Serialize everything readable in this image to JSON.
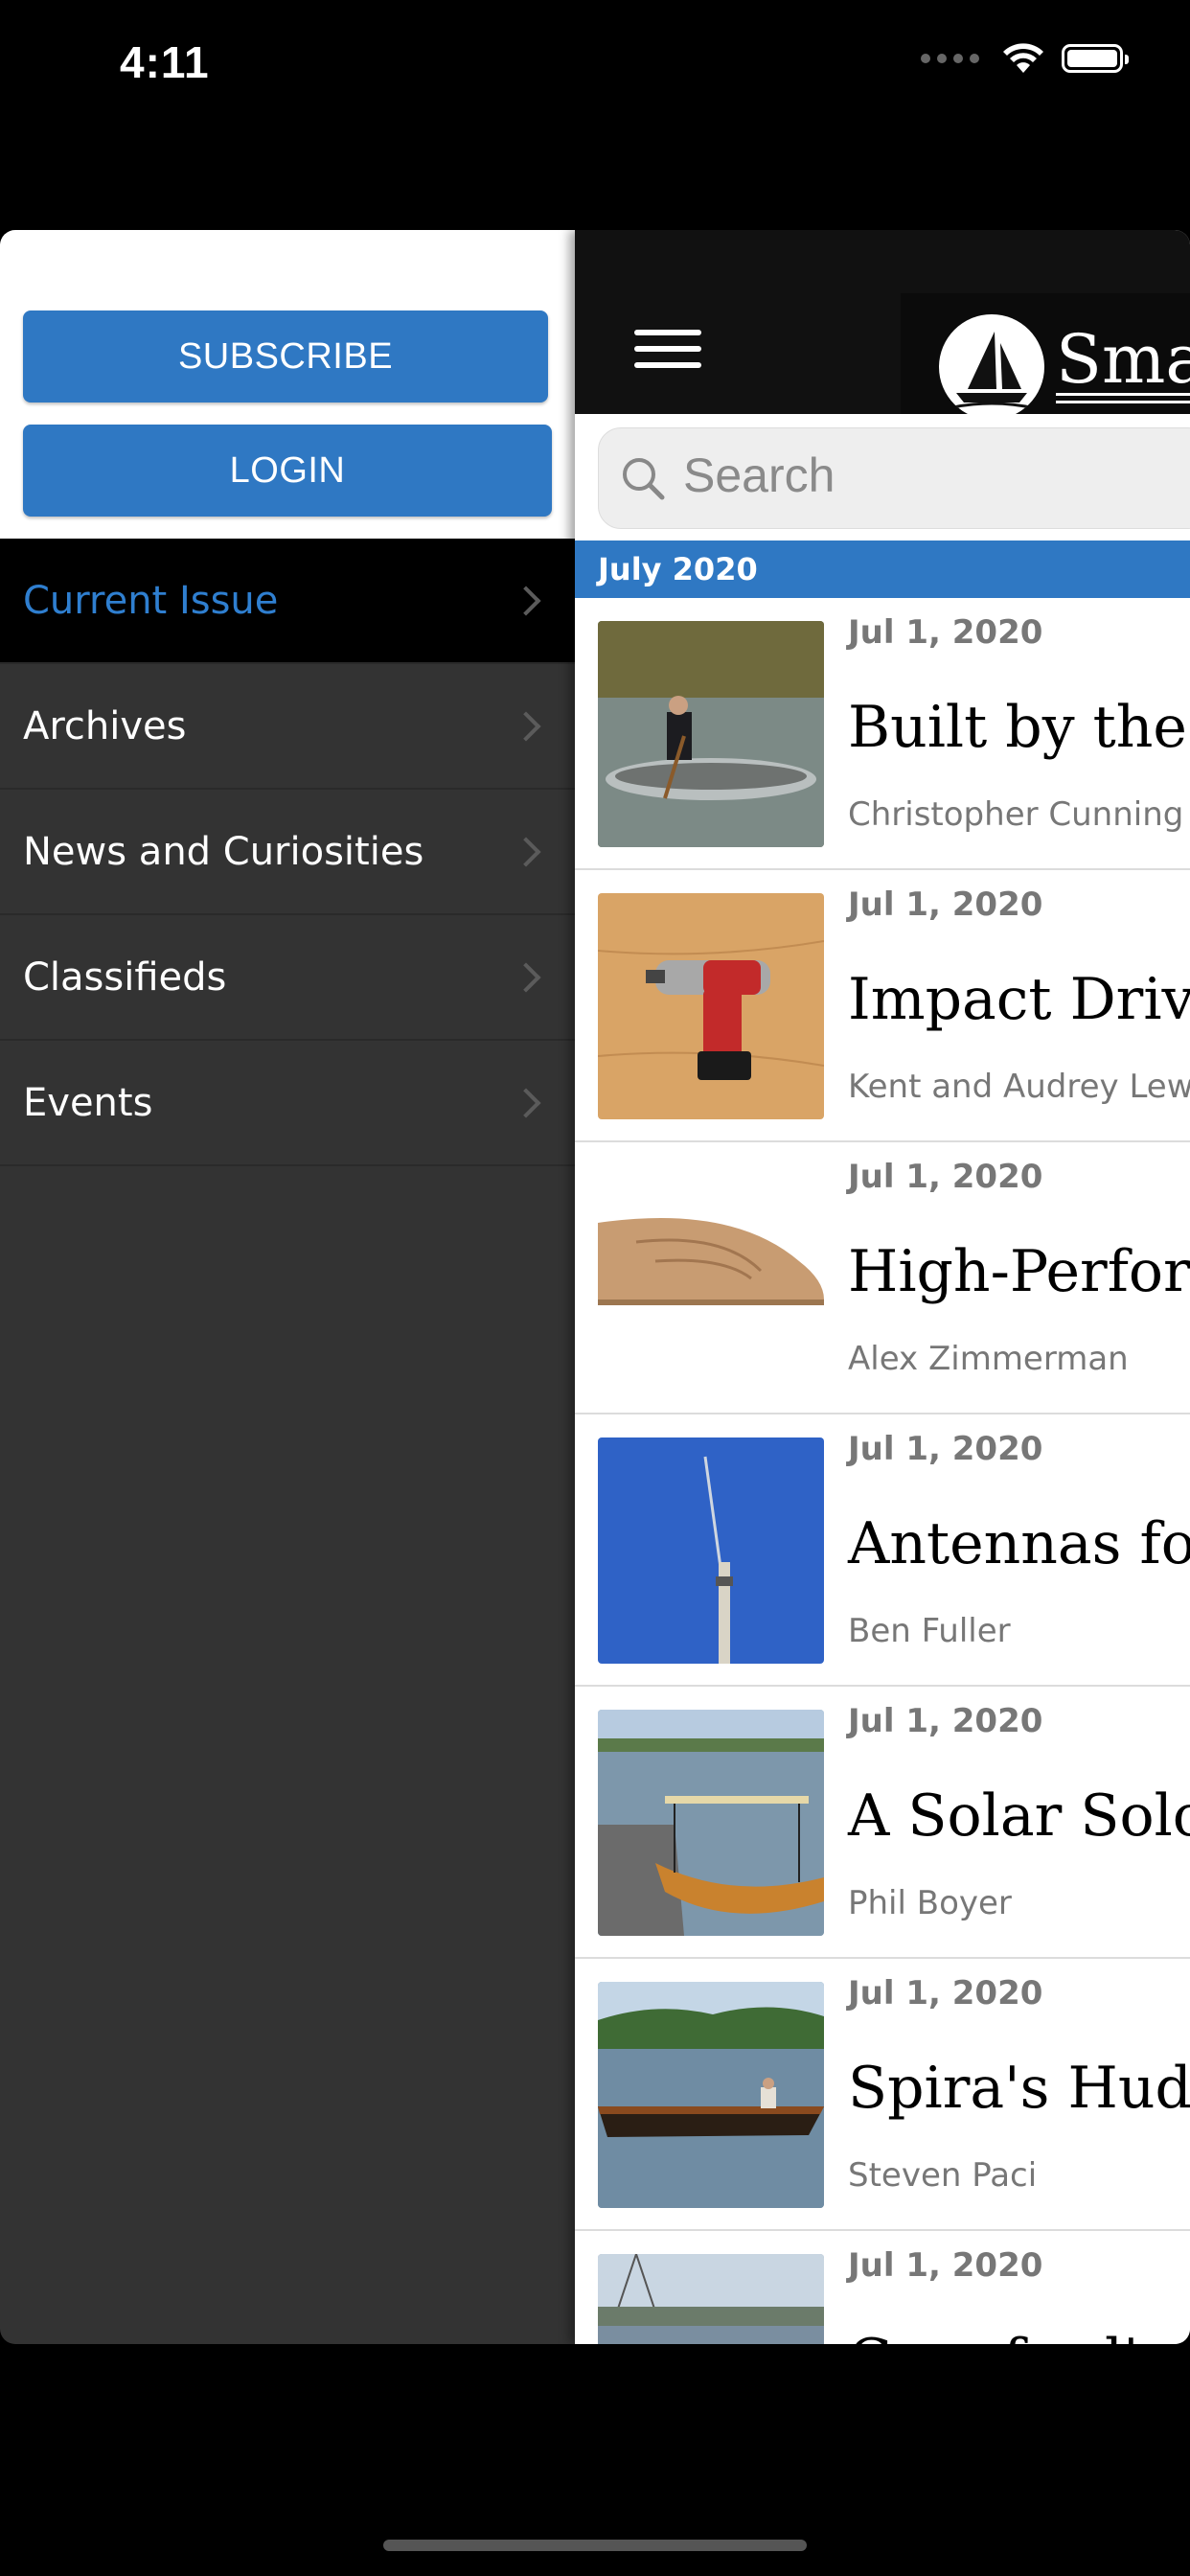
{
  "status": {
    "time": "4:11"
  },
  "drawer": {
    "subscribe_label": "SUBSCRIBE",
    "login_label": "LOGIN",
    "menu": [
      {
        "label": "Current Issue",
        "active": true
      },
      {
        "label": "Archives"
      },
      {
        "label": "News and Curiosities"
      },
      {
        "label": "Classifieds"
      },
      {
        "label": "Events"
      }
    ]
  },
  "header": {
    "logo_text": "Small"
  },
  "search": {
    "placeholder": "Search"
  },
  "section": {
    "title": "July 2020"
  },
  "articles": [
    {
      "date": "Jul 1, 2020",
      "title": "Built by the Bo",
      "author": "Christopher Cunning"
    },
    {
      "date": "Jul 1, 2020",
      "title": "Impact Driver",
      "author": "Kent and Audrey Lew"
    },
    {
      "date": "Jul 1, 2020",
      "title": "High-Perform",
      "author": "Alex Zimmerman"
    },
    {
      "date": "Jul 1, 2020",
      "title": "Antennas for V",
      "author": "Ben Fuller"
    },
    {
      "date": "Jul 1, 2020",
      "title": "A Solar Solo",
      "author": "Phil Boyer"
    },
    {
      "date": "Jul 1, 2020",
      "title": "Spira's Hudson",
      "author": "Steven Paci"
    },
    {
      "date": "Jul 1, 2020",
      "title": "Crawford's Ca",
      "author": ""
    }
  ],
  "colors": {
    "accent": "#2f78c3",
    "drawer_bg": "#333333",
    "active_text": "#2f7fd0"
  }
}
